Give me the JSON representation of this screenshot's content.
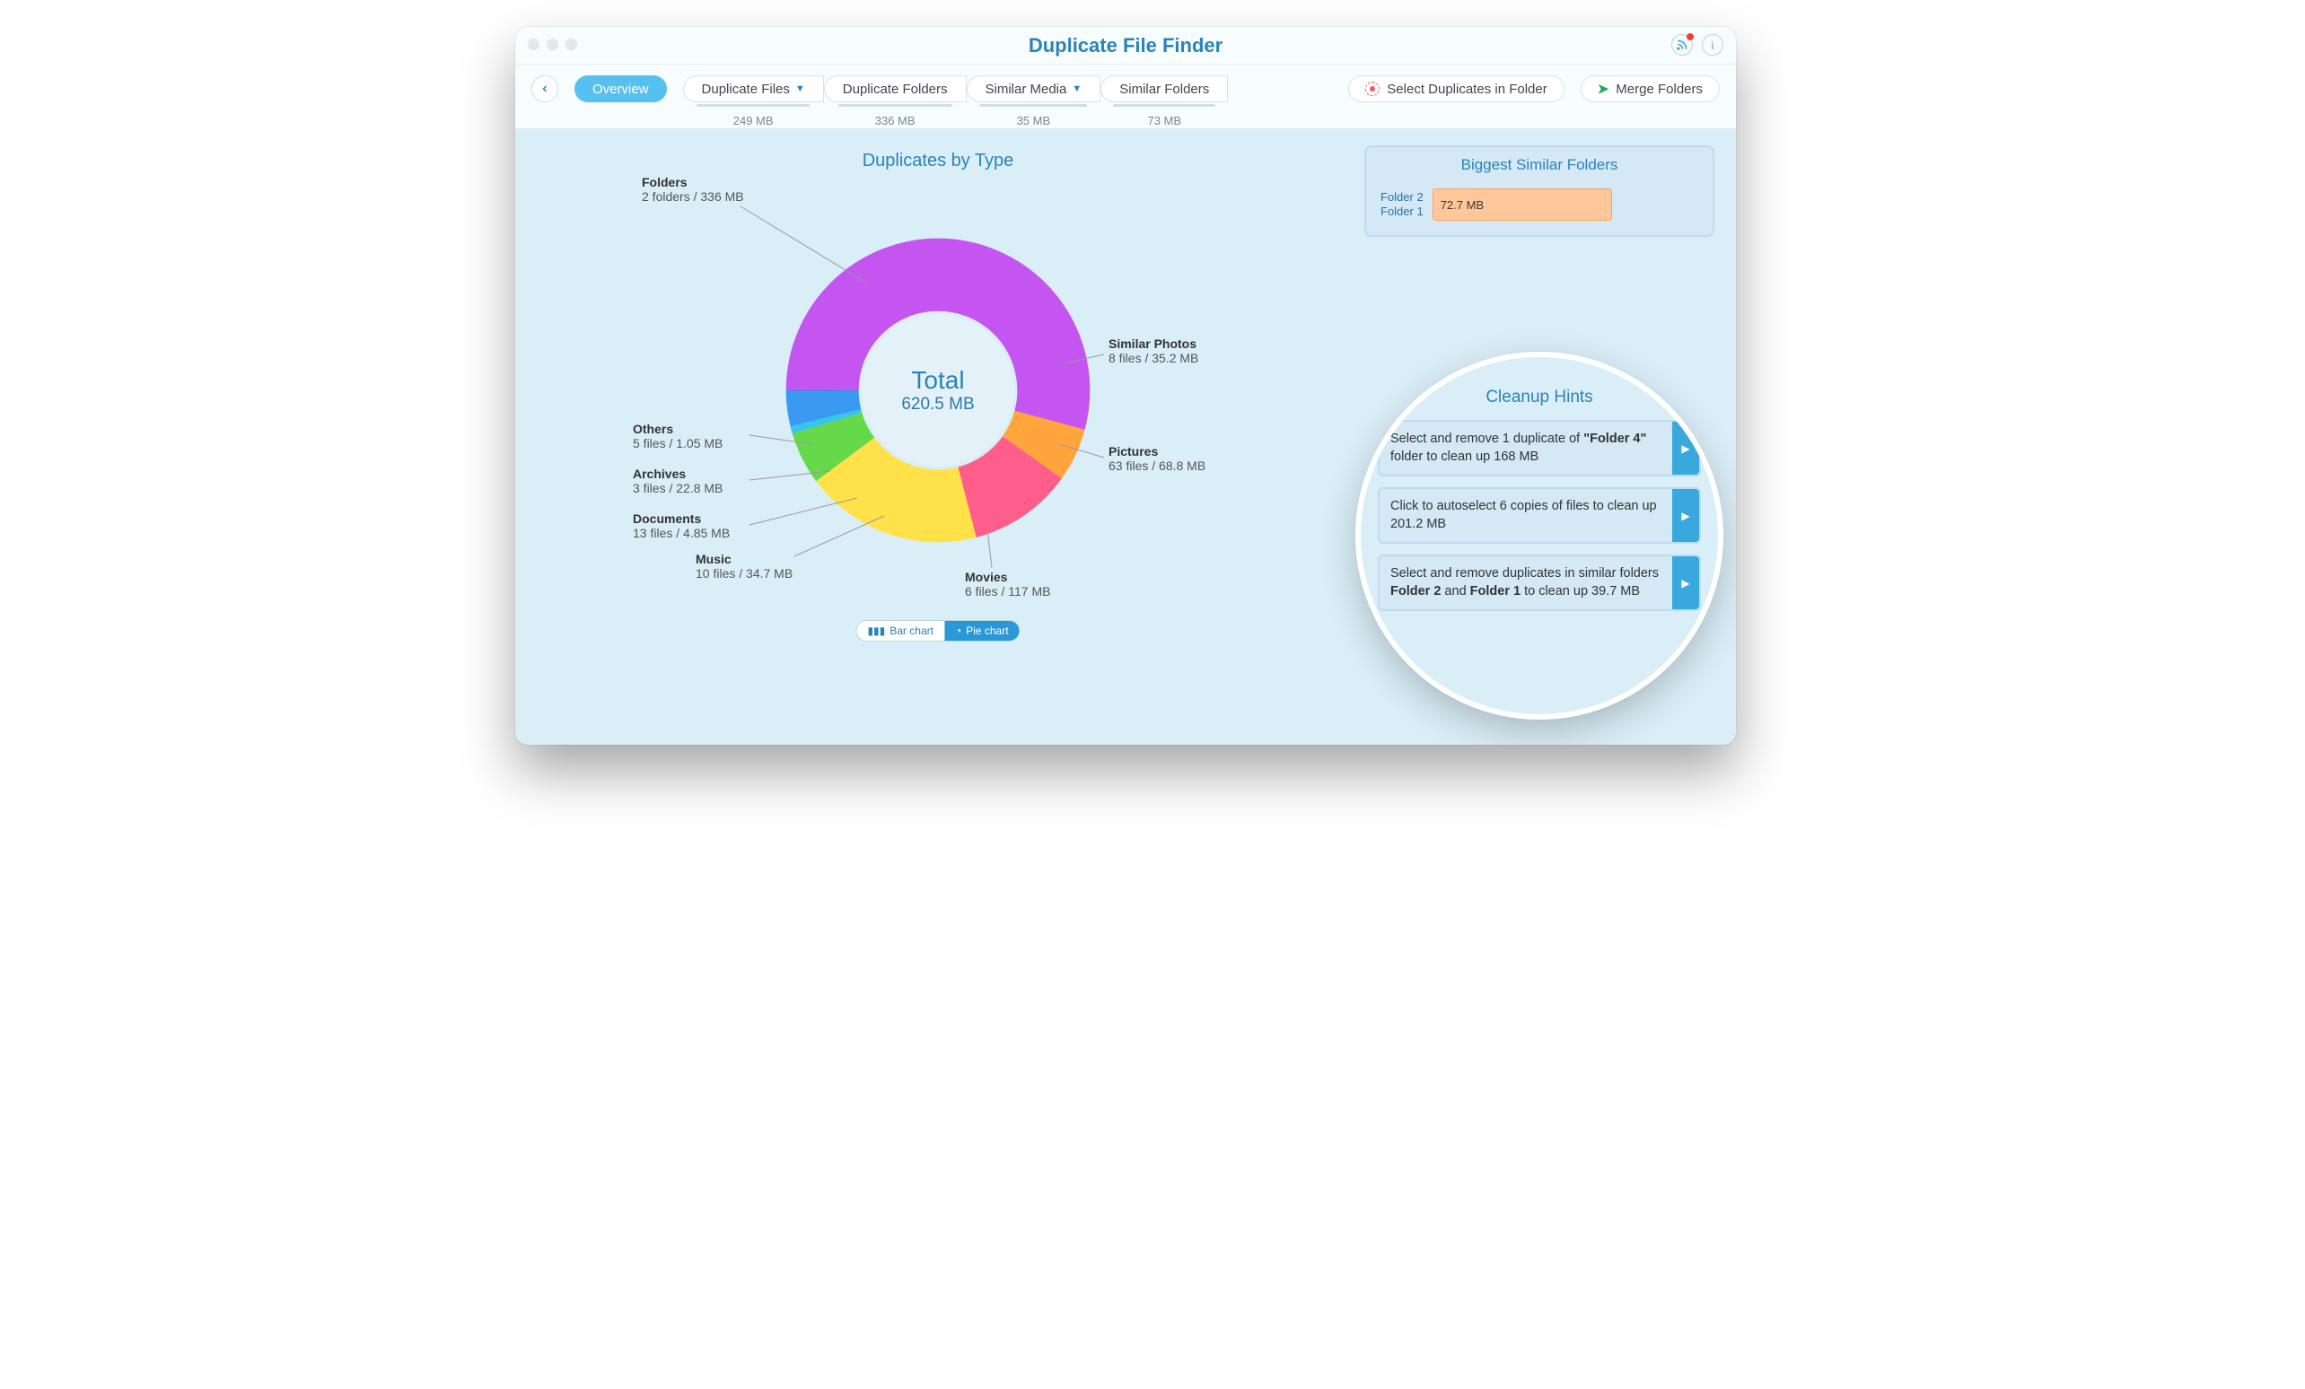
{
  "app": {
    "title": "Duplicate File Finder"
  },
  "toolbar": {
    "overview": "Overview",
    "select_in_folder": "Select Duplicates in Folder",
    "merge": "Merge Folders",
    "tabs": [
      {
        "label": "Duplicate Files",
        "size": "249 MB",
        "dropdown": true
      },
      {
        "label": "Duplicate Folders",
        "size": "336 MB",
        "dropdown": false
      },
      {
        "label": "Similar Media",
        "size": "35 MB",
        "dropdown": true
      },
      {
        "label": "Similar Folders",
        "size": "73 MB",
        "dropdown": false
      }
    ]
  },
  "chart": {
    "title": "Duplicates by Type",
    "center_label": "Total",
    "center_value": "620.5 MB",
    "toggle": {
      "bar": "Bar chart",
      "pie": "Pie chart",
      "active": "pie"
    },
    "labels": {
      "folders": {
        "title": "Folders",
        "sub": "2 folders / 336 MB"
      },
      "similar_photos": {
        "title": "Similar Photos",
        "sub": "8 files / 35.2 MB"
      },
      "pictures": {
        "title": "Pictures",
        "sub": "63 files / 68.8 MB"
      },
      "movies": {
        "title": "Movies",
        "sub": "6 files / 117 MB"
      },
      "music": {
        "title": "Music",
        "sub": "10 files / 34.7 MB"
      },
      "documents": {
        "title": "Documents",
        "sub": "13 files / 4.85 MB"
      },
      "archives": {
        "title": "Archives",
        "sub": "3 files / 22.8 MB"
      },
      "others": {
        "title": "Others",
        "sub": "5 files / 1.05 MB"
      }
    }
  },
  "chart_data": {
    "type": "pie",
    "title": "Duplicates by Type",
    "total_label": "Total",
    "total_value_mb": 620.5,
    "series": [
      {
        "name": "Folders",
        "value_mb": 336,
        "count": 2,
        "color": "#c455f0"
      },
      {
        "name": "Similar Photos",
        "value_mb": 35.2,
        "count": 8,
        "color": "#ffa53b"
      },
      {
        "name": "Pictures",
        "value_mb": 68.8,
        "count": 63,
        "color": "#ff5e8a"
      },
      {
        "name": "Movies",
        "value_mb": 117,
        "count": 6,
        "color": "#ffe24a"
      },
      {
        "name": "Music",
        "value_mb": 34.7,
        "count": 10,
        "color": "#66d94a"
      },
      {
        "name": "Documents",
        "value_mb": 4.85,
        "count": 13,
        "color": "#36c6e8"
      },
      {
        "name": "Archives",
        "value_mb": 22.8,
        "count": 3,
        "color": "#3a9af2"
      },
      {
        "name": "Others",
        "value_mb": 1.05,
        "count": 5,
        "color": "#2b7bdc"
      }
    ]
  },
  "similar_folders": {
    "title": "Biggest Similar Folders",
    "rows": [
      {
        "name_top": "Folder 2",
        "name_bottom": "Folder 1",
        "size": "72.7 MB"
      }
    ]
  },
  "hints": {
    "title": "Cleanup Hints",
    "items": [
      {
        "pre": "Select and remove 1 duplicate of ",
        "bold": "\"Folder 4\"",
        "post": " folder to clean up 168 MB"
      },
      {
        "pre": "Click to autoselect 6 copies of files to clean up 201.2 MB",
        "bold": "",
        "post": ""
      },
      {
        "pre": "Select and remove duplicates in similar folders ",
        "bold": "Folder 2",
        "mid": " and ",
        "bold2": "Folder 1",
        "post": " to clean up 39.7 MB"
      }
    ]
  }
}
